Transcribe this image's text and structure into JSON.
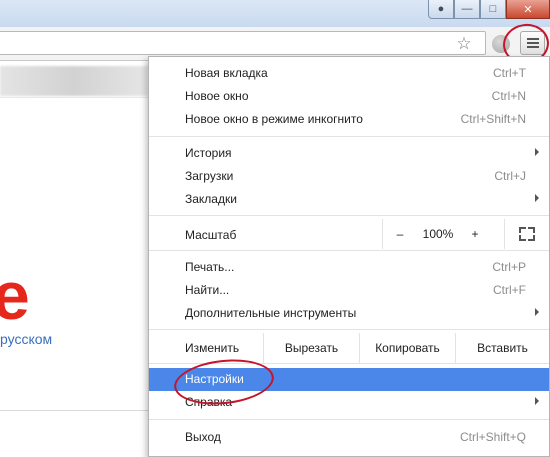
{
  "page": {
    "logo_letter": "e",
    "language_link": "русском"
  },
  "menu": {
    "items_top": [
      {
        "label": "Новая вкладка",
        "shortcut": "Ctrl+T"
      },
      {
        "label": "Новое окно",
        "shortcut": "Ctrl+N"
      },
      {
        "label": "Новое окно в режиме инкогнито",
        "shortcut": "Ctrl+Shift+N"
      }
    ],
    "items_nav": [
      {
        "label": "История",
        "shortcut": ""
      },
      {
        "label": "Загрузки",
        "shortcut": "Ctrl+J"
      },
      {
        "label": "Закладки",
        "shortcut": ""
      }
    ],
    "zoom": {
      "label": "Масштаб",
      "minus": "–",
      "value": "100%",
      "plus": "+"
    },
    "items_tools": [
      {
        "label": "Печать...",
        "shortcut": "Ctrl+P"
      },
      {
        "label": "Найти...",
        "shortcut": "Ctrl+F"
      },
      {
        "label": "Дополнительные инструменты",
        "shortcut": ""
      }
    ],
    "edit": {
      "label": "Изменить",
      "cut": "Вырезать",
      "copy": "Копировать",
      "paste": "Вставить"
    },
    "settings": {
      "label": "Настройки"
    },
    "help": {
      "label": "Справка"
    },
    "exit": {
      "label": "Выход",
      "shortcut": "Ctrl+Shift+Q"
    }
  },
  "colors": {
    "highlight": "#4a87e8",
    "annotation": "#c4152a",
    "logo": "#e6271c"
  },
  "icons": {
    "window_user": "user-icon",
    "window_minimize": "minimize-icon",
    "window_maximize": "maximize-icon",
    "window_close": "close-icon",
    "bookmark": "star-icon",
    "extension": "globe-icon",
    "menu": "hamburger-menu-icon"
  }
}
